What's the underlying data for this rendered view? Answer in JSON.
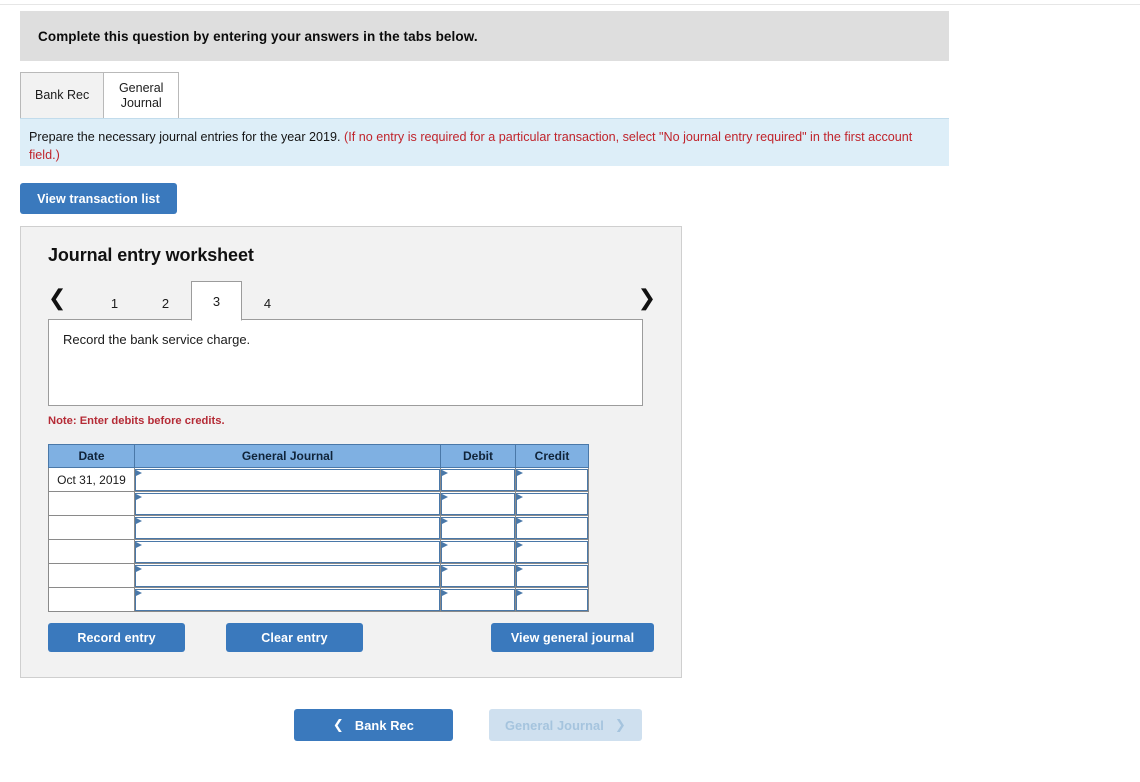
{
  "question_header": {
    "text": "Complete this question by entering your answers in the tabs below."
  },
  "tabs": [
    {
      "label": "Bank Rec",
      "active": false
    },
    {
      "label": "General\nJournal",
      "active": true
    }
  ],
  "instruction_banner": {
    "black_text": "Prepare the necessary journal entries for the year 2019. ",
    "red_text": "(If no entry is required for a particular transaction, select \"No journal entry required\" in the first account field.)"
  },
  "toolbar": {
    "view_transaction_list_label": "View transaction list"
  },
  "worksheet": {
    "title": "Journal entry worksheet",
    "pager": {
      "prev_icon": "chevron-left-icon",
      "next_icon": "chevron-right-icon",
      "pages": [
        "1",
        "2",
        "3",
        "4"
      ],
      "active_page": "3"
    },
    "description": "Record the bank service charge.",
    "note": "Note: Enter debits before credits.",
    "table": {
      "headers": [
        "Date",
        "General Journal",
        "Debit",
        "Credit"
      ],
      "rows": [
        {
          "date": "Oct 31, 2019",
          "general_journal": "",
          "debit": "",
          "credit": ""
        },
        {
          "date": "",
          "general_journal": "",
          "debit": "",
          "credit": ""
        },
        {
          "date": "",
          "general_journal": "",
          "debit": "",
          "credit": ""
        },
        {
          "date": "",
          "general_journal": "",
          "debit": "",
          "credit": ""
        },
        {
          "date": "",
          "general_journal": "",
          "debit": "",
          "credit": ""
        },
        {
          "date": "",
          "general_journal": "",
          "debit": "",
          "credit": ""
        }
      ]
    },
    "actions": {
      "record_entry_label": "Record entry",
      "clear_entry_label": "Clear entry",
      "view_general_journal_label": "View general journal"
    }
  },
  "bottom_nav": {
    "prev_label": "Bank Rec",
    "prev_icon": "chevron-left-icon",
    "next_label": "General Journal",
    "next_icon": "chevron-right-icon"
  },
  "colors": {
    "accent_blue": "#3a79bd",
    "table_header_blue": "#7fb0e2",
    "banner_blue": "#ddeef8",
    "header_grey": "#dedede",
    "red_text": "#c0242c",
    "note_red": "#b52b36",
    "disabled_blue": "#cfe0ef"
  }
}
